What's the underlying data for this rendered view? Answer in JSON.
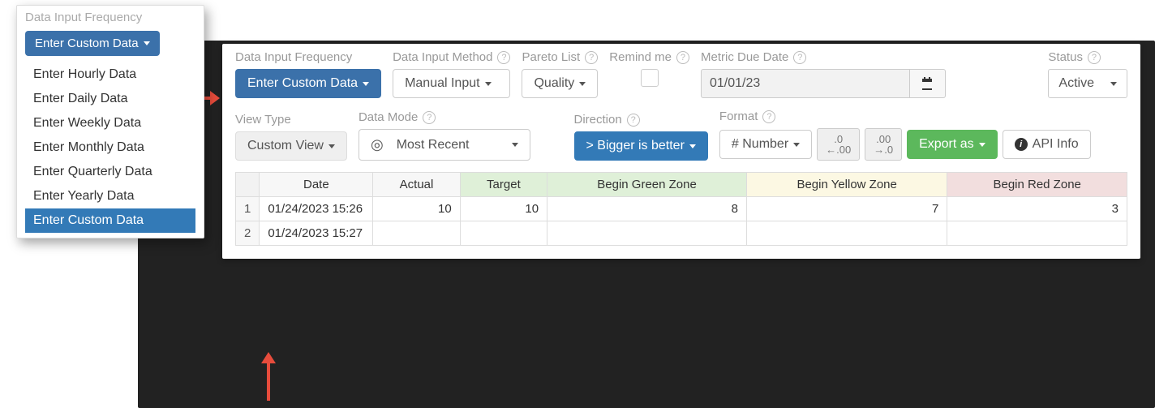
{
  "popover": {
    "title": "Data Input Frequency",
    "button_label": "Enter Custom Data",
    "items": [
      "Enter Hourly Data",
      "Enter Daily Data",
      "Enter Weekly Data",
      "Enter Monthly Data",
      "Enter Quarterly Data",
      "Enter Yearly Data",
      "Enter Custom Data"
    ],
    "selected_index": 6
  },
  "labels": {
    "data_input_frequency": "Data Input Frequency",
    "data_input_method": "Data Input Method",
    "pareto_list": "Pareto List",
    "remind_me": "Remind me",
    "metric_due_date": "Metric Due Date",
    "status": "Status",
    "view_type": "View Type",
    "data_mode": "Data Mode",
    "direction": "Direction",
    "format": "Format"
  },
  "controls": {
    "enter_custom_data": "Enter Custom Data",
    "manual_input": "Manual Input",
    "quality": "Quality",
    "due_date_value": "01/01/23",
    "status_value": "Active",
    "custom_view": "Custom View",
    "most_recent": "Most Recent",
    "direction_value": "> Bigger is better",
    "format_value": "# Number",
    "export_as": "Export as",
    "api_info": "API Info"
  },
  "table": {
    "headers": {
      "date": "Date",
      "actual": "Actual",
      "target": "Target",
      "green": "Begin Green Zone",
      "yellow": "Begin Yellow Zone",
      "red": "Begin Red Zone"
    },
    "rows": [
      {
        "n": "1",
        "date": "01/24/2023 15:26",
        "actual": "10",
        "target": "10",
        "green": "8",
        "yellow": "7",
        "red": "3"
      },
      {
        "n": "2",
        "date": "01/24/2023 15:27",
        "actual": "",
        "target": "",
        "green": "",
        "yellow": "",
        "red": ""
      }
    ]
  }
}
